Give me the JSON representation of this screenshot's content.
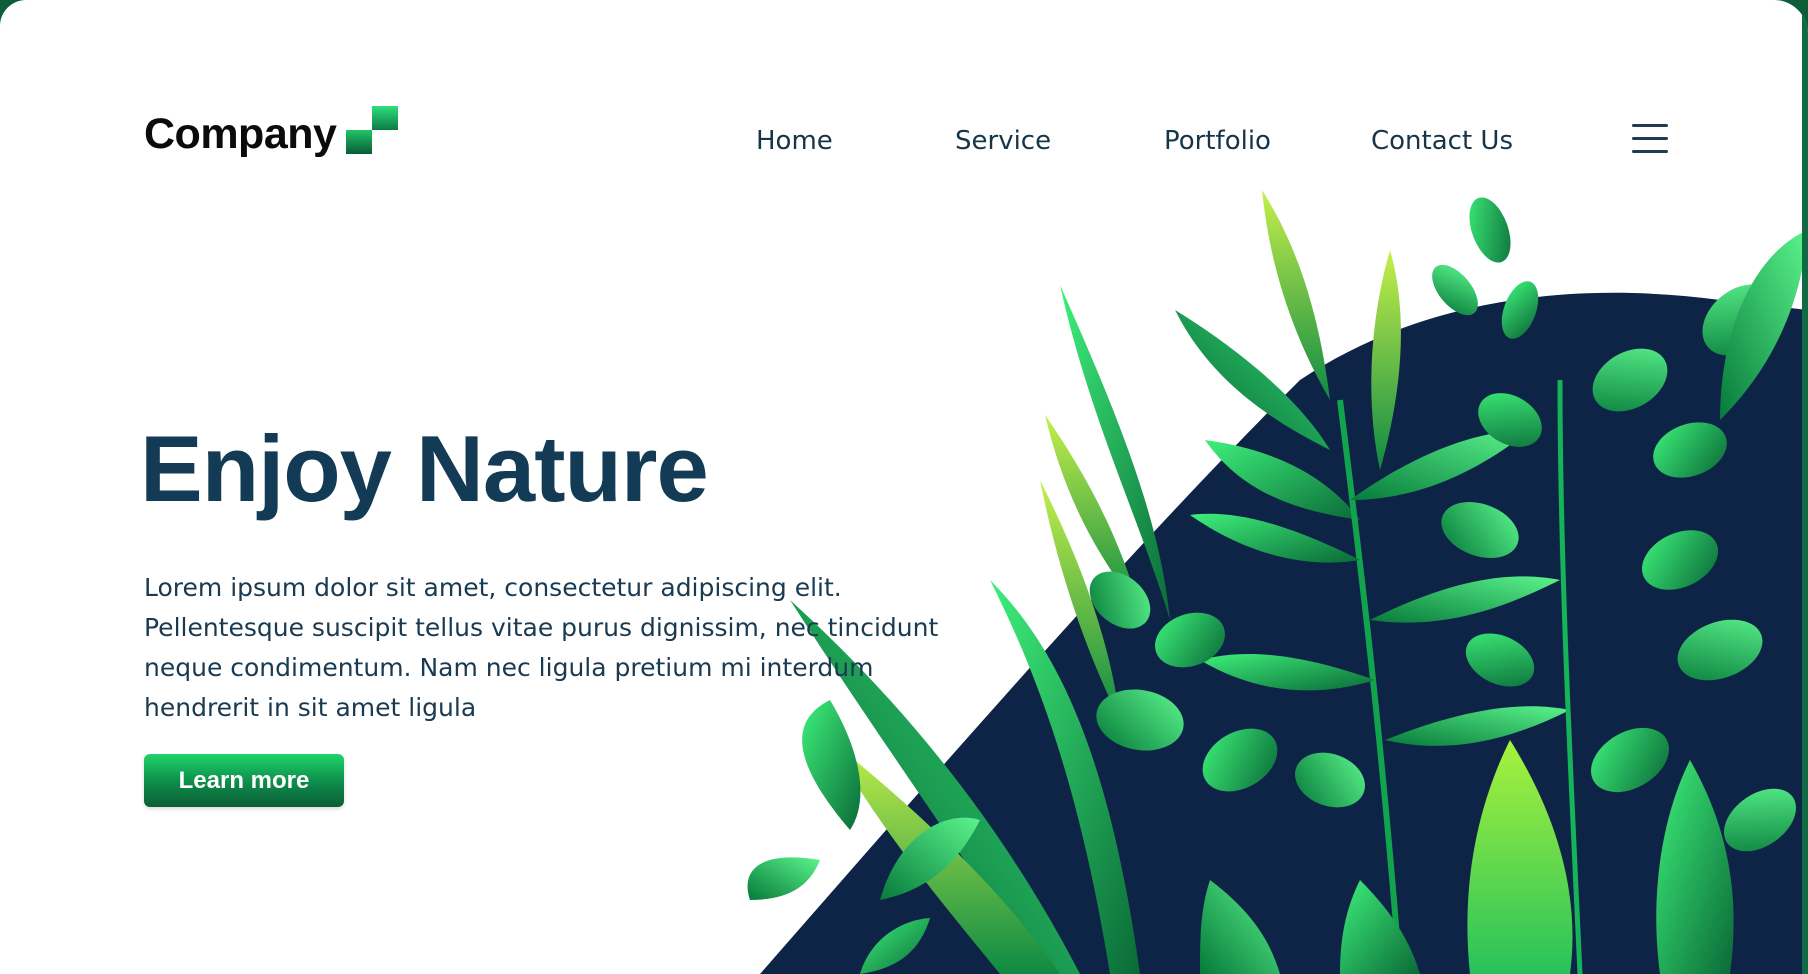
{
  "brand": {
    "name": "Company"
  },
  "nav": {
    "items": [
      {
        "label": "Home"
      },
      {
        "label": "Service"
      },
      {
        "label": "Portfolio"
      },
      {
        "label": "Contact Us"
      }
    ],
    "menu_icon": "hamburger-menu-icon"
  },
  "hero": {
    "title": "Enjoy Nature",
    "body": "Lorem ipsum dolor sit amet, consectetur adipiscing elit. Pellentesque suscipit tellus vitae purus dignissim, nec tincidunt neque condimentum. Nam nec ligula pretium mi interdum hendrerit in sit amet ligula",
    "cta_label": "Learn more"
  },
  "colors": {
    "heading": "#143b55",
    "accent_green": "#1fd46a",
    "dark_navy": "#0e2447",
    "leaf_green": "#15a84c"
  }
}
